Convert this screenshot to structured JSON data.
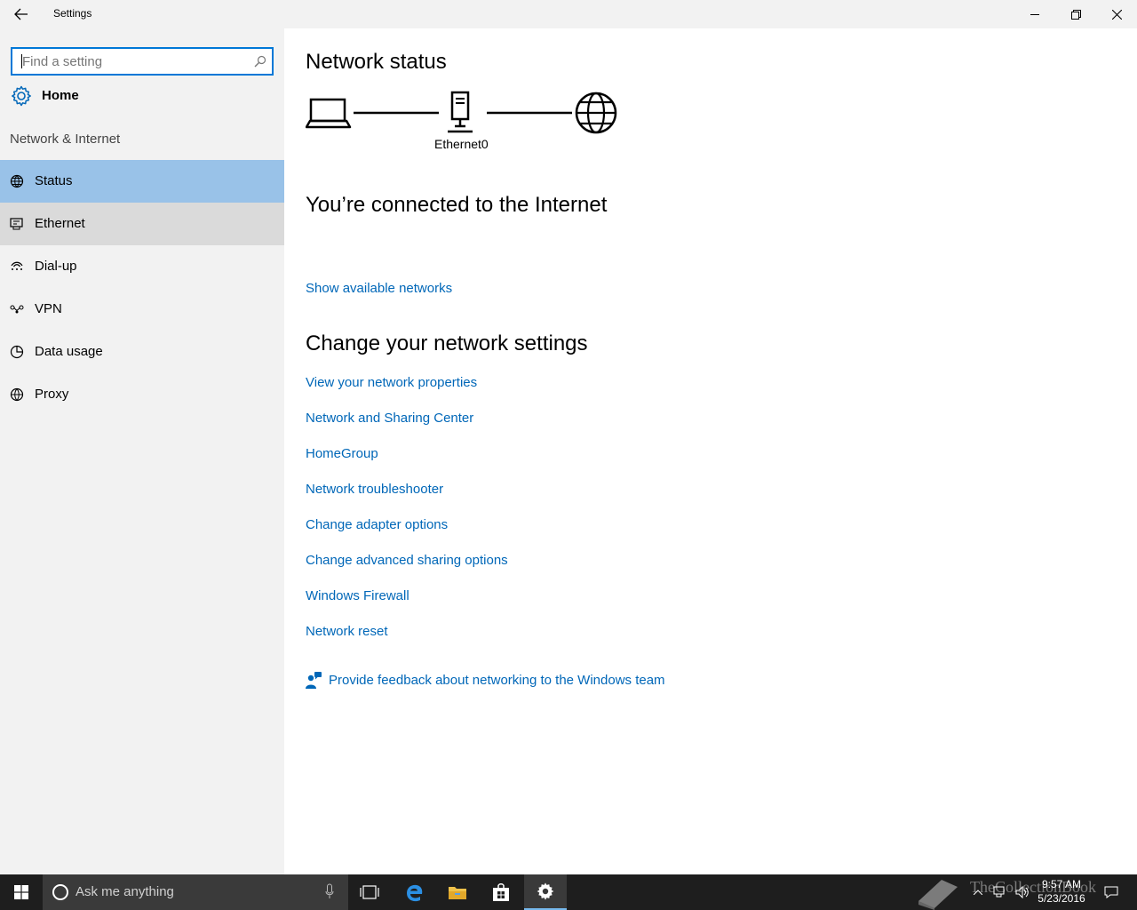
{
  "window": {
    "title": "Settings"
  },
  "sidebar": {
    "search_placeholder": "Find a setting",
    "home_label": "Home",
    "section_title": "Network & Internet",
    "items": [
      {
        "label": "Status",
        "icon": "globe-status-icon",
        "state": "selected"
      },
      {
        "label": "Ethernet",
        "icon": "ethernet-icon",
        "state": "hover"
      },
      {
        "label": "Dial-up",
        "icon": "dialup-icon",
        "state": "normal"
      },
      {
        "label": "VPN",
        "icon": "vpn-icon",
        "state": "normal"
      },
      {
        "label": "Data usage",
        "icon": "data-usage-icon",
        "state": "normal"
      },
      {
        "label": "Proxy",
        "icon": "proxy-globe-icon",
        "state": "normal"
      }
    ]
  },
  "main": {
    "status_heading": "Network status",
    "adapter_name": "Ethernet0",
    "connected_text": "You’re connected to the Internet",
    "show_networks_link": "Show available networks",
    "change_heading": "Change your network settings",
    "links": [
      "View your network properties",
      "Network and Sharing Center",
      "HomeGroup",
      "Network troubleshooter",
      "Change adapter options",
      "Change advanced sharing options",
      "Windows Firewall",
      "Network reset"
    ],
    "feedback_link": "Provide feedback about networking to the Windows team"
  },
  "taskbar": {
    "search_text": "Ask me anything",
    "time": "9:57 AM",
    "date": "5/23/2016",
    "watermark": "TheCollectionBook"
  },
  "colors": {
    "accent": "#0078d7",
    "link": "#0067b8",
    "selected": "#99c2e8",
    "sidebar_bg": "#f2f2f2",
    "taskbar_bg": "#1e1e1e"
  }
}
